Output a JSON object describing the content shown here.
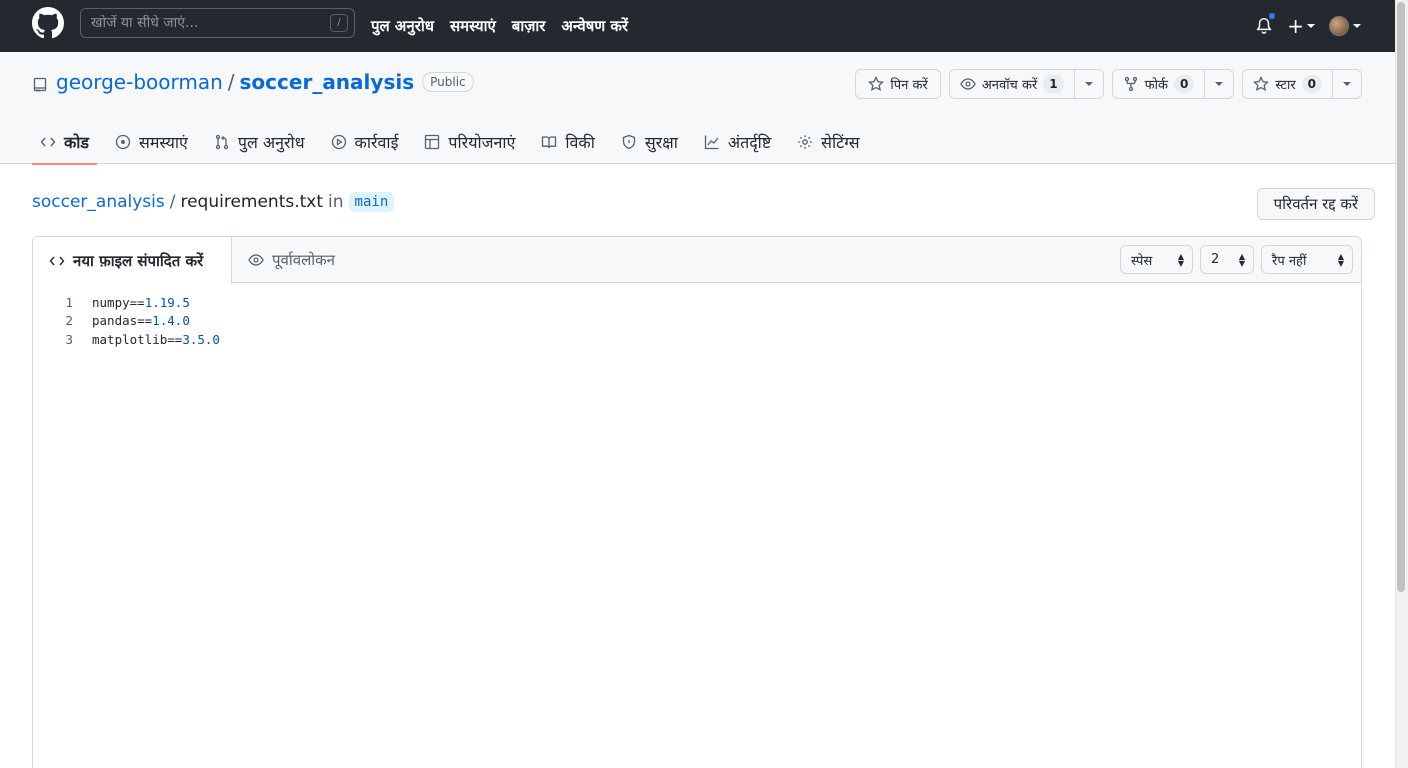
{
  "header": {
    "search_placeholder": "खोजें या सीधे जाएं...",
    "search_key": "/",
    "nav": [
      "पुल अनुरोध",
      "समस्याएं",
      "बाज़ार",
      "अन्वेषण करें"
    ],
    "plus": "+"
  },
  "repo": {
    "owner": "george-boorman",
    "separator": "/",
    "name": "soccer_analysis",
    "visibility": "Public",
    "pin_label": "पिन करें",
    "watch_label": "अनवॉच करें",
    "watch_count": "1",
    "fork_label": "फोर्क",
    "fork_count": "0",
    "star_label": "स्टार",
    "star_count": "0"
  },
  "tabs": [
    {
      "label": "कोड",
      "icon": "code-icon"
    },
    {
      "label": "समस्याएं",
      "icon": "issue-icon"
    },
    {
      "label": "पुल अनुरोध",
      "icon": "pull-request-icon"
    },
    {
      "label": "कार्रवाई",
      "icon": "play-icon"
    },
    {
      "label": "परियोजनाएं",
      "icon": "table-icon"
    },
    {
      "label": "विकी",
      "icon": "book-icon"
    },
    {
      "label": "सुरक्षा",
      "icon": "shield-icon"
    },
    {
      "label": "अंतर्दृष्टि",
      "icon": "graph-icon"
    },
    {
      "label": "सेटिंग्स",
      "icon": "gear-icon"
    }
  ],
  "breadcrumb": {
    "repo": "soccer_analysis",
    "sep": "/",
    "file": "requirements.txt",
    "in": "in",
    "branch": "main"
  },
  "cancel_label": "परिवर्तन रद्द करें",
  "editor": {
    "edit_tab": "नया फ़ाइल संपादित करें",
    "preview_tab": "पूर्वावलोकन",
    "indent_mode": "स्पेस",
    "indent_size": "2",
    "wrap_mode": "रैप नहीं",
    "lines": [
      {
        "no": "1",
        "pkg": "numpy==",
        "ver": "1.19.5"
      },
      {
        "no": "2",
        "pkg": "pandas==",
        "ver": "1.4.0"
      },
      {
        "no": "3",
        "pkg": "matplotlib==",
        "ver": "3.5.0"
      }
    ]
  },
  "colors": {
    "header_bg": "#24292f",
    "link": "#0969da",
    "active_tab_underline": "#fd8c73",
    "notification_dot": "#2f81f7"
  }
}
